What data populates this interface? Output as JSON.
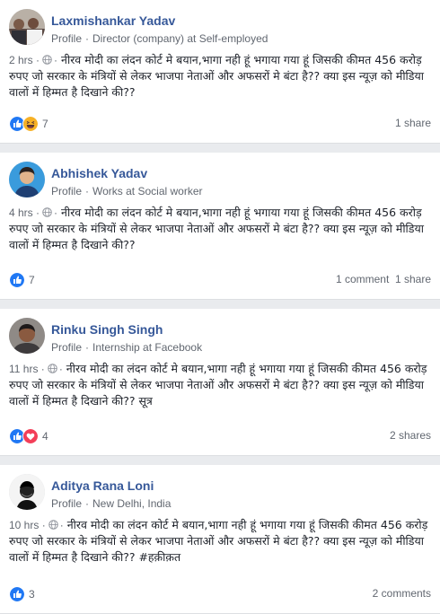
{
  "posts": [
    {
      "author": "Laxmishankar Yadav",
      "profile_label": "Profile",
      "subtitle": "Director (company) at Self-employed",
      "time": "2 hrs",
      "text": "नीरव मोदी का लंदन कोर्ट मे बयान,भागा नही हूं भगाया गया हूं जिसकी कीमत 456 करोड़ रुपए जो सरकार के मंत्रियों से लेकर भाजपा नेताओं और अफसरों मे बंटा है?? क्या इस न्यूज़ को मीडिया वालों में हिम्मत है दिखाने की??",
      "reactions": [
        "like",
        "haha"
      ],
      "reaction_count": "7",
      "stats": "1 share"
    },
    {
      "author": "Abhishek Yadav",
      "profile_label": "Profile",
      "subtitle": "Works at Social worker",
      "time": "4 hrs",
      "text": "नीरव मोदी का लंदन कोर्ट मे बयान,भागा नही हूं भगाया गया हूं जिसकी कीमत 456 करोड़ रुपए जो सरकार के मंत्रियों से लेकर भाजपा नेताओं और अफसरों मे बंटा है?? क्या इस न्यूज़ को मीडिया वालों में हिम्मत है दिखाने की??",
      "reactions": [
        "like"
      ],
      "reaction_count": "7",
      "stats": "1 comment  1 share"
    },
    {
      "author": "Rinku Singh Singh",
      "profile_label": "Profile",
      "subtitle": "Internship at Facebook",
      "time": "11 hrs",
      "text": "नीरव मोदी का लंदन कोर्ट मे बयान,भागा नही हूं भगाया गया हूं जिसकी कीमत 456 करोड़ रुपए जो सरकार के मंत्रियों से लेकर भाजपा नेताओं और अफसरों मे बंटा है?? क्या इस न्यूज़ को मीडिया वालों में हिम्मत है दिखाने की?? सूत्र",
      "reactions": [
        "like",
        "love"
      ],
      "reaction_count": "4",
      "stats": "2 shares"
    },
    {
      "author": "Aditya Rana Loni",
      "profile_label": "Profile",
      "subtitle": "New Delhi, India",
      "time": "10 hrs",
      "text": "नीरव मोदी का लंदन कोर्ट मे बयान,भागा नही हूं भगाया गया हूं जिसकी कीमत 456 करोड़ रुपए जो सरकार के मंत्रियों से लेकर भाजपा नेताओं और अफसरों मे बंटा है?? क्या इस न्यूज़ को मीडिया वालों में हिम्मत है दिखाने की?? #हक़ीक़त",
      "reactions": [
        "like"
      ],
      "reaction_count": "3",
      "stats": "2 comments"
    }
  ],
  "colors": {
    "author": "#365899",
    "like": "#2078f4",
    "love": "#f33e58",
    "haha": "#f7b125"
  },
  "icons": {
    "privacy": "globe-icon",
    "like": "like-reaction-icon",
    "love": "love-reaction-icon",
    "haha": "haha-reaction-icon"
  }
}
